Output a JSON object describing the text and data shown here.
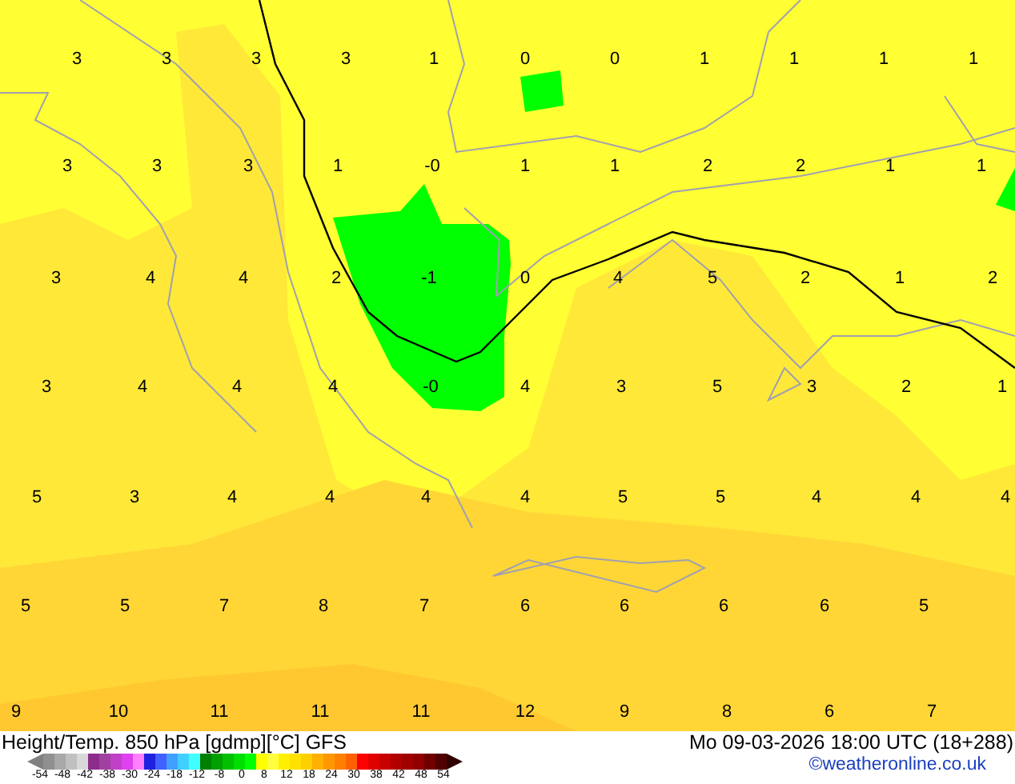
{
  "map": {
    "temperature_rows": [
      [
        "3",
        "3",
        "3",
        "3",
        "1",
        "0",
        "0",
        "1",
        "1",
        "1",
        "1"
      ],
      [
        "3",
        "3",
        "3",
        "1",
        "-0",
        "1",
        "1",
        "2",
        "2",
        "1",
        "1"
      ],
      [
        "3",
        "4",
        "4",
        "2",
        "-1",
        "0",
        "4",
        "5",
        "2",
        "1",
        "2"
      ],
      [
        "3",
        "4",
        "4",
        "4",
        "-0",
        "4",
        "3",
        "5",
        "3",
        "2",
        "1"
      ],
      [
        "5",
        "3",
        "4",
        "4",
        "4",
        "4",
        "5",
        "5",
        "4",
        "4",
        "4"
      ],
      [
        "5",
        "5",
        "7",
        "8",
        "7",
        "6",
        "6",
        "6",
        "6",
        "5"
      ],
      [
        "9",
        "10",
        "11",
        "11",
        "11",
        "12",
        "9",
        "8",
        "6",
        "7"
      ]
    ]
  },
  "legend": {
    "title": "Height/Temp. 850 hPa [gdmp][°C] GFS",
    "valid_time": "Mo 09-03-2026 18:00 UTC (18+288)",
    "credit": "©weatheronline.co.uk",
    "scale_steps": [
      {
        "color": "#909090"
      },
      {
        "color": "#a8a8a8"
      },
      {
        "color": "#c0c0c0"
      },
      {
        "color": "#d8d8d8"
      },
      {
        "color": "#8c2d8c"
      },
      {
        "color": "#a040a0"
      },
      {
        "color": "#c040c8"
      },
      {
        "color": "#e040f0"
      },
      {
        "color": "#ff80ff"
      },
      {
        "color": "#2020e0"
      },
      {
        "color": "#4060ff"
      },
      {
        "color": "#40a0ff"
      },
      {
        "color": "#40d0ff"
      },
      {
        "color": "#40ffff"
      },
      {
        "color": "#008000"
      },
      {
        "color": "#00a000"
      },
      {
        "color": "#00c000"
      },
      {
        "color": "#00e000"
      },
      {
        "color": "#00ff00"
      },
      {
        "color": "#ffff00"
      },
      {
        "color": "#ffff40"
      },
      {
        "color": "#fff000"
      },
      {
        "color": "#ffe000"
      },
      {
        "color": "#ffd000"
      },
      {
        "color": "#ffb000"
      },
      {
        "color": "#ff9800"
      },
      {
        "color": "#ff8000"
      },
      {
        "color": "#ff6000"
      },
      {
        "color": "#ff0000"
      },
      {
        "color": "#e00000"
      },
      {
        "color": "#c80000"
      },
      {
        "color": "#b00000"
      },
      {
        "color": "#a00000"
      },
      {
        "color": "#900000"
      },
      {
        "color": "#700000"
      },
      {
        "color": "#500000"
      }
    ],
    "scale_ticks": [
      "-54",
      "-48",
      "-42",
      "-38",
      "-30",
      "-24",
      "-18",
      "-12",
      "-8",
      "0",
      "8",
      "12",
      "18",
      "24",
      "30",
      "38",
      "42",
      "48",
      "54"
    ]
  }
}
